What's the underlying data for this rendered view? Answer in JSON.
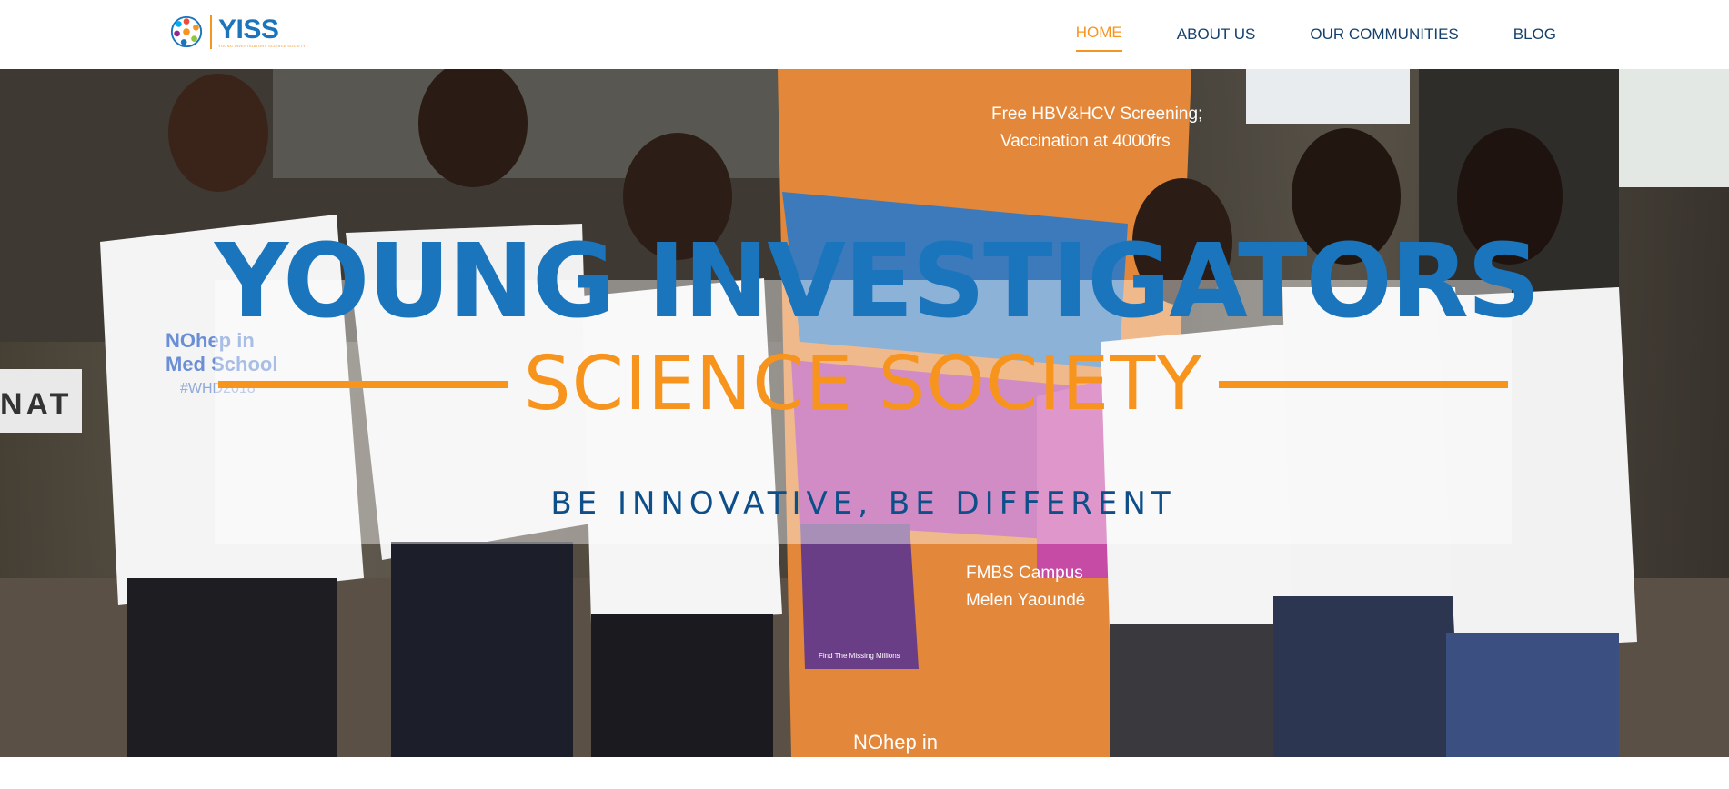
{
  "header": {
    "logo": {
      "wordmark": "YISS",
      "tagline": "YOUNG INVESTIGATORS SCIENCE SOCIETY"
    },
    "nav": [
      {
        "label": "HOME",
        "active": true
      },
      {
        "label": "ABOUT US",
        "active": false
      },
      {
        "label": "OUR COMMUNITIES",
        "active": false
      },
      {
        "label": "BLOG",
        "active": false
      }
    ]
  },
  "hero": {
    "title_line1": "YOUNG INVESTIGATORS",
    "title_line2": "SCIENCE SOCIETY",
    "tagline": "BE INNOVATIVE, BE DIFFERENT",
    "photo_texts": {
      "banner_1": "Free HBV&HCV Screening;",
      "banner_2": "Vaccination at 4000frs",
      "banner_3": "FMBS Campus",
      "banner_4": "Melen Yaoundé",
      "banner_5": "Find The Missing Millions",
      "banner_6": "NOhep in",
      "shirt_1": "NOhep in",
      "shirt_2": "Med School",
      "shirt_3": "#WHD2018",
      "sign": "NAT"
    }
  },
  "colors": {
    "brand_blue": "#1a75bc",
    "brand_orange": "#f7941d",
    "nav_text": "#14406b",
    "tagline": "#0e4f8a"
  }
}
